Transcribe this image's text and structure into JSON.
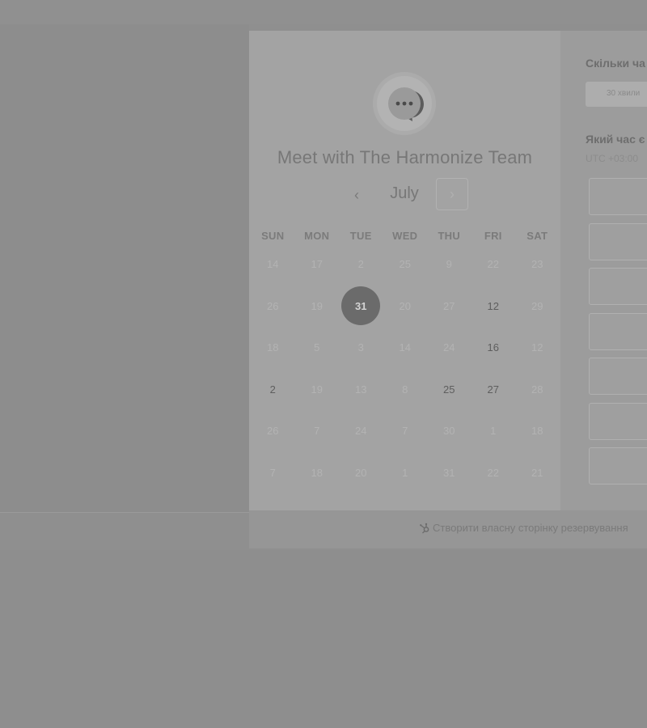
{
  "booking": {
    "title": "Meet with The Harmonize Team",
    "month": "July",
    "weekdays": [
      "SUN",
      "MON",
      "TUE",
      "WED",
      "THU",
      "FRI",
      "SAT"
    ],
    "weeks": [
      [
        {
          "d": "14",
          "s": "muted"
        },
        {
          "d": "17",
          "s": "muted"
        },
        {
          "d": "2",
          "s": "muted"
        },
        {
          "d": "25",
          "s": "muted"
        },
        {
          "d": "9",
          "s": "muted"
        },
        {
          "d": "22",
          "s": "muted"
        },
        {
          "d": "23",
          "s": "muted"
        }
      ],
      [
        {
          "d": "26",
          "s": "muted"
        },
        {
          "d": "19",
          "s": "muted"
        },
        {
          "d": "31",
          "s": "selected"
        },
        {
          "d": "20",
          "s": "muted"
        },
        {
          "d": "27",
          "s": "muted"
        },
        {
          "d": "12",
          "s": "available"
        },
        {
          "d": "29",
          "s": "muted"
        }
      ],
      [
        {
          "d": "18",
          "s": "muted"
        },
        {
          "d": "5",
          "s": "muted"
        },
        {
          "d": "3",
          "s": "muted"
        },
        {
          "d": "14",
          "s": "muted"
        },
        {
          "d": "24",
          "s": "muted"
        },
        {
          "d": "16",
          "s": "available"
        },
        {
          "d": "12",
          "s": "muted"
        }
      ],
      [
        {
          "d": "2",
          "s": "available"
        },
        {
          "d": "19",
          "s": "muted"
        },
        {
          "d": "13",
          "s": "muted"
        },
        {
          "d": "8",
          "s": "muted"
        },
        {
          "d": "25",
          "s": "available"
        },
        {
          "d": "27",
          "s": "available"
        },
        {
          "d": "28",
          "s": "muted"
        }
      ],
      [
        {
          "d": "26",
          "s": "muted"
        },
        {
          "d": "7",
          "s": "muted"
        },
        {
          "d": "24",
          "s": "muted"
        },
        {
          "d": "7",
          "s": "muted"
        },
        {
          "d": "30",
          "s": "muted"
        },
        {
          "d": "1",
          "s": "muted"
        },
        {
          "d": "18",
          "s": "muted"
        }
      ],
      [
        {
          "d": "7",
          "s": "muted"
        },
        {
          "d": "18",
          "s": "muted"
        },
        {
          "d": "20",
          "s": "muted"
        },
        {
          "d": "1",
          "s": "muted"
        },
        {
          "d": "31",
          "s": "muted"
        },
        {
          "d": "22",
          "s": "muted"
        },
        {
          "d": "21",
          "s": "muted"
        }
      ]
    ]
  },
  "right_panel": {
    "duration_question": "Скільки ча",
    "duration_value": "30 хвили",
    "time_question": "Який час є",
    "timezone": "UTC +03:00",
    "slot_count": 7
  },
  "footer": {
    "link_text": "Створити власну сторінку резервування"
  },
  "icons": {
    "logo": "chat-bubble-logo-icon",
    "prev": "chevron-left-icon",
    "next": "chevron-right-icon",
    "footer": "hubspot-sprocket-icon"
  }
}
